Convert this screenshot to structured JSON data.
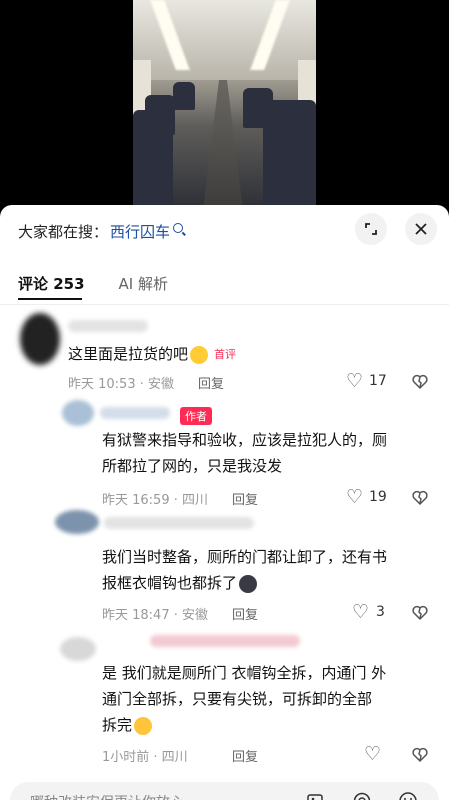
{
  "header": {
    "search_prefix": "大家都在搜：",
    "search_term": "西行囚车"
  },
  "tabs": [
    {
      "label": "评论 253"
    },
    {
      "label": "AI 解析"
    }
  ],
  "comments": [
    {
      "lines": [
        "这里面是拉货的吧"
      ],
      "badge": "首评",
      "emoji": "grin",
      "meta": "昨天 10:53 · 安徽",
      "reply": "回复",
      "likes": "17"
    },
    {
      "author_badge": "作者",
      "lines": [
        "有狱警来指导和验收，应该是拉犯人的，厕",
        "所都拉了网的，只是我没发"
      ],
      "meta": "昨天 16:59 · 四川",
      "reply": "回复",
      "likes": "19"
    },
    {
      "lines": [
        "我们当时整备，厕所的门都让卸了，还有书",
        "报框衣帽钩也都拆了"
      ],
      "emoji": "black",
      "meta": "昨天 18:47 · 安徽",
      "reply": "回复",
      "likes": "3"
    },
    {
      "lines": [
        "是 我们就是厕所门 衣帽钩全拆，内通门 外",
        "通门全部拆，只要有尖锐，可拆卸的全部",
        "拆完"
      ],
      "meta": "1小时前 · 四川",
      "reply": "回复",
      "likes": ""
    }
  ],
  "input": {
    "placeholder": "哪种改装安保更让你放心"
  }
}
